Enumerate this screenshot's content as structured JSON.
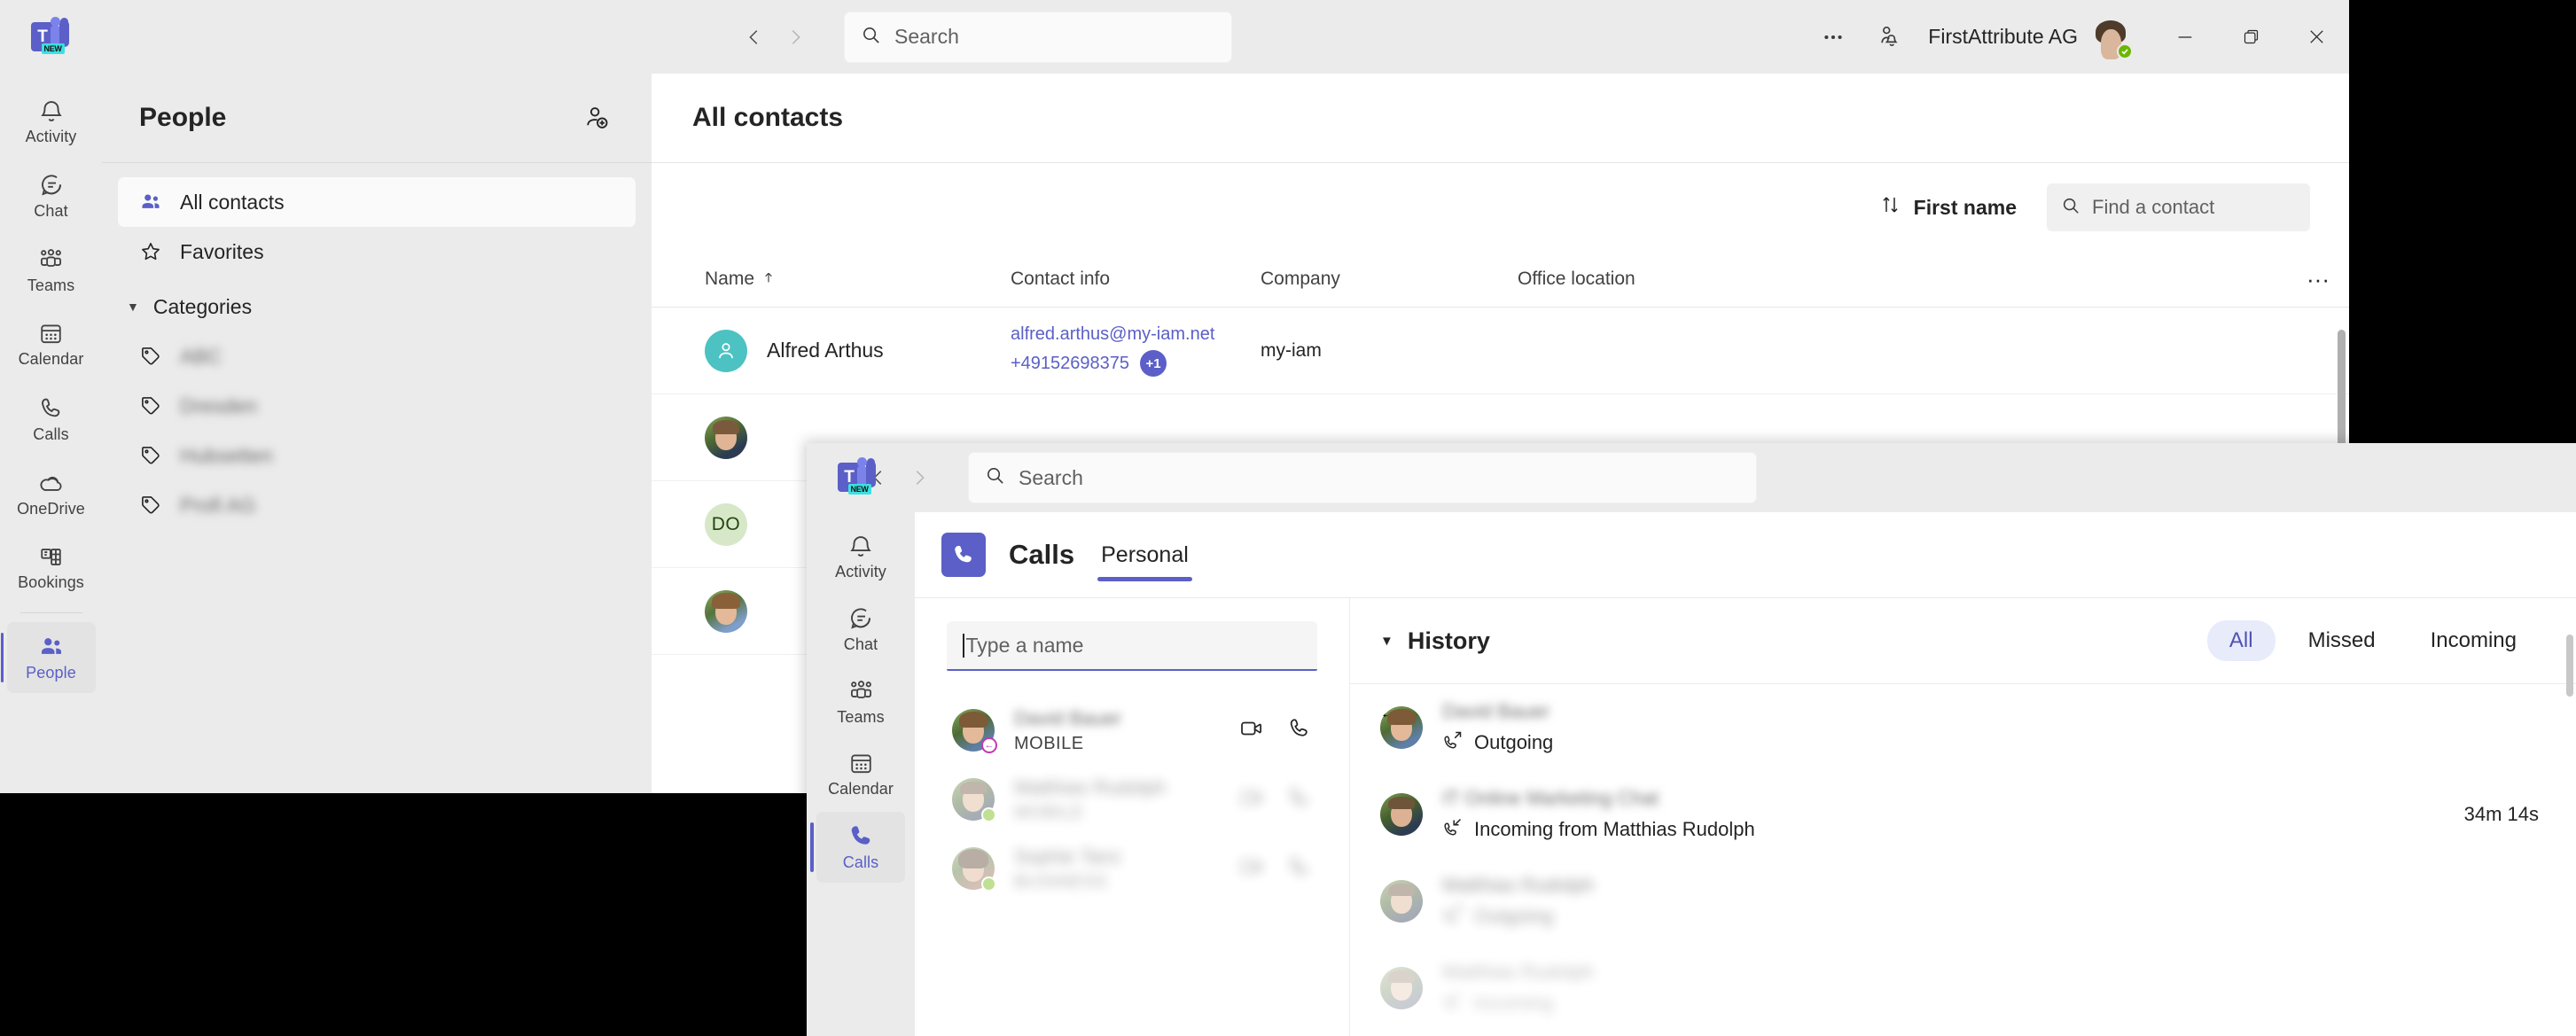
{
  "people_window": {
    "titlebar": {
      "app_logo": "teams-logo",
      "logo_badge": "NEW",
      "back_icon": "chevron-left-icon",
      "forward_icon": "chevron-right-icon",
      "search": {
        "icon": "search-icon",
        "placeholder": "Search",
        "value": ""
      },
      "more_icon": "ellipsis-icon",
      "notification_icon": "bell-person-icon",
      "account_name": "FirstAttribute AG",
      "avatar": "user-avatar",
      "presence": "available",
      "minimize_icon": "minimize-icon",
      "maximize_icon": "restore-icon",
      "close_icon": "close-icon"
    },
    "rail": [
      {
        "label": "Activity",
        "icon": "bell-icon",
        "active": false
      },
      {
        "label": "Chat",
        "icon": "chat-icon",
        "active": false
      },
      {
        "label": "Teams",
        "icon": "teams-icon",
        "active": false
      },
      {
        "label": "Calendar",
        "icon": "calendar-icon",
        "active": false
      },
      {
        "label": "Calls",
        "icon": "phone-icon",
        "active": false
      },
      {
        "label": "OneDrive",
        "icon": "onedrive-icon",
        "active": false
      },
      {
        "label": "Bookings",
        "icon": "bookings-icon",
        "active": false
      },
      {
        "label": "People",
        "icon": "people-icon",
        "active": true
      }
    ],
    "left_nav": {
      "title": "People",
      "add_contact_icon": "person-add-icon",
      "items": [
        {
          "label": "All contacts",
          "icon": "people-icon",
          "selected": true
        },
        {
          "label": "Favorites",
          "icon": "star-icon",
          "selected": false
        }
      ],
      "categories_label": "Categories",
      "categories_caret": "caret-down-icon",
      "categories": [
        {
          "label": "ABC",
          "icon": "tag-icon",
          "redacted": true
        },
        {
          "label": "Dresden",
          "icon": "tag-icon",
          "redacted": true
        },
        {
          "label": "Hubsetten",
          "icon": "tag-icon",
          "redacted": true
        },
        {
          "label": "Profi AG",
          "icon": "tag-icon",
          "redacted": true
        }
      ]
    },
    "content": {
      "title": "All contacts",
      "sort_label": "First name",
      "sort_icon": "sort-arrows-icon",
      "find": {
        "icon": "search-icon",
        "placeholder": "Find a contact",
        "value": ""
      },
      "columns": [
        "Name",
        "Contact info",
        "Company",
        "Office location"
      ],
      "name_sort_indicator": "arrow-up-icon",
      "more_icon": "ellipsis-icon",
      "rows": [
        {
          "name": "Alfred Arthus",
          "avatar_type": "initials-teal",
          "email": "alfred.arthus@my-iam.net",
          "phone": "+49152698375",
          "phone_badge": "+1",
          "company": "my-iam",
          "office_location": ""
        },
        {
          "name": "",
          "avatar_type": "photo",
          "email": "",
          "phone": "",
          "phone_badge": "",
          "company": "",
          "office_location": "",
          "redacted": true
        },
        {
          "name": "",
          "avatar_type": "initials",
          "avatar_initials": "DO",
          "email": "",
          "phone": "",
          "phone_badge": "",
          "company": "",
          "office_location": "",
          "redacted": true
        },
        {
          "name": "",
          "avatar_type": "photo",
          "email": "",
          "phone": "",
          "phone_badge": "",
          "company": "",
          "office_location": "",
          "redacted": true
        }
      ]
    }
  },
  "calls_window": {
    "titlebar": {
      "app_logo": "teams-logo",
      "logo_badge": "NEW",
      "back_icon": "chevron-left-icon",
      "forward_icon": "chevron-right-icon",
      "search": {
        "icon": "search-icon",
        "placeholder": "Search",
        "value": ""
      }
    },
    "rail": [
      {
        "label": "Activity",
        "icon": "bell-icon",
        "active": false
      },
      {
        "label": "Chat",
        "icon": "chat-icon",
        "active": false
      },
      {
        "label": "Teams",
        "icon": "teams-icon",
        "active": false
      },
      {
        "label": "Calendar",
        "icon": "calendar-icon",
        "active": false
      },
      {
        "label": "Calls",
        "icon": "phone-icon",
        "active": true
      }
    ],
    "header": {
      "badge_icon": "phone-icon",
      "title": "Calls",
      "tab_label": "Personal",
      "tab_active": true
    },
    "dial": {
      "input_placeholder": "Type a name",
      "input_value": "",
      "focused": true,
      "suggestions": [
        {
          "name": "David Bauer",
          "subtitle": "MOBILE",
          "avatar": "photo",
          "presence": "offline-call",
          "video_icon": "video-call-icon",
          "call_icon": "phone-call-icon",
          "redacted_name": true
        },
        {
          "name": "Matthias Rudolph",
          "subtitle": "MOBILE",
          "avatar": "photo",
          "presence": "available",
          "video_icon": "video-call-icon",
          "call_icon": "phone-call-icon",
          "redacted_name": true
        },
        {
          "name": "Sophie Tanz",
          "subtitle": "BUSINESS",
          "avatar": "photo",
          "presence": "available",
          "video_icon": "video-call-icon",
          "call_icon": "phone-call-icon",
          "redacted_name": true
        }
      ]
    },
    "history": {
      "title": "History",
      "caret_icon": "caret-down-icon",
      "filters": [
        {
          "label": "All",
          "active": true
        },
        {
          "label": "Missed",
          "active": false
        },
        {
          "label": "Incoming",
          "active": false
        }
      ],
      "rows": [
        {
          "name": "David Bauer",
          "direction": "Outgoing",
          "direction_icon": "call-outgoing-icon",
          "duration": "",
          "avatar": "photo",
          "presence": "offline-call",
          "redacted_name": true
        },
        {
          "name": "IT Online Marketing Chat",
          "direction": "Incoming from Matthias Rudolph",
          "direction_icon": "call-incoming-icon",
          "duration": "34m 14s",
          "avatar": "photo",
          "presence": "",
          "redacted_name": true
        },
        {
          "name": "Matthias Rudolph",
          "direction": "Outgoing",
          "direction_icon": "call-outgoing-icon",
          "duration": "",
          "avatar": "photo",
          "presence": "available",
          "redacted_name": true,
          "dim": true
        },
        {
          "name": "Matthias Rudolph",
          "direction": "Incoming",
          "direction_icon": "call-incoming-icon",
          "duration": "",
          "avatar": "photo",
          "presence": "available",
          "redacted_name": true,
          "dim": true
        }
      ]
    }
  },
  "colors": {
    "accent": "#5b5fc7",
    "accent_soft": "#e8ebfa",
    "available": "#6bb700",
    "window_chrome": "#ebebeb",
    "surface": "#ffffff",
    "text": "#242424",
    "secondary_text": "#616161",
    "teal_avatar": "#4cc2c2"
  }
}
